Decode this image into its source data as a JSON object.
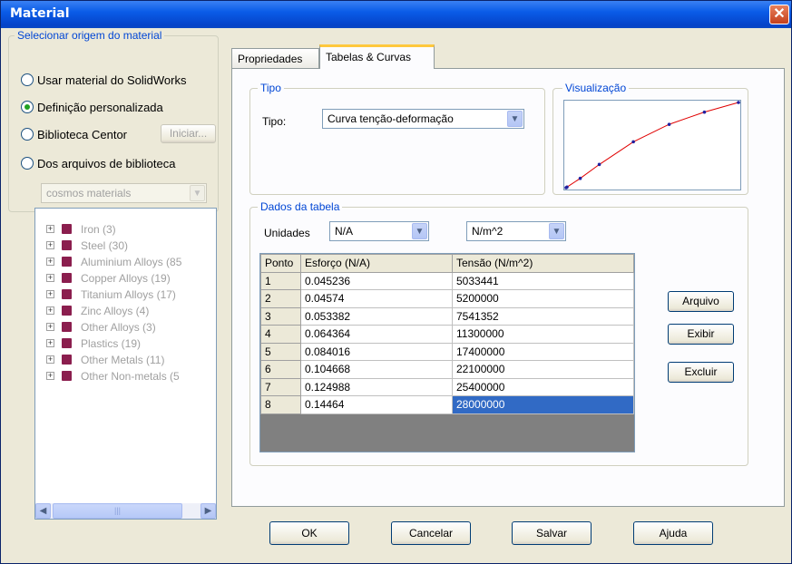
{
  "window": {
    "title": "Material"
  },
  "source": {
    "legend": "Selecionar origem do material",
    "options": [
      {
        "label": "Usar material do SolidWorks",
        "selected": false
      },
      {
        "label": "Definição personalizada",
        "selected": true
      },
      {
        "label": "Biblioteca Centor",
        "selected": false
      },
      {
        "label": "Dos arquivos de biblioteca",
        "selected": false
      }
    ],
    "iniciar_label": "Iniciar...",
    "library_value": "cosmos materials",
    "tree": [
      "Iron (3)",
      "Steel (30)",
      "Aluminium Alloys (85",
      "Copper Alloys (19)",
      "Titanium Alloys (17)",
      "Zinc Alloys (4)",
      "Other Alloys (3)",
      "Plastics (19)",
      "Other Metals (11)",
      "Other Non-metals (5"
    ]
  },
  "tabs": [
    {
      "label": "Propriedades",
      "active": false
    },
    {
      "label": "Tabelas & Curvas",
      "active": true
    }
  ],
  "tipo": {
    "legend": "Tipo",
    "label": "Tipo:",
    "value": "Curva tenção-deformação"
  },
  "preview": {
    "legend": "Visualização",
    "line_color": "#e00000",
    "point_color": "#2020a0"
  },
  "table_data": {
    "legend": "Dados da tabela",
    "units_label": "Unidades",
    "unit_strain": "N/A",
    "unit_stress": "N/m^2",
    "headers": [
      "Ponto",
      "Esforço (N/A)",
      "Tensão (N/m^2)"
    ],
    "rows": [
      [
        "1",
        "0.045236",
        "5033441"
      ],
      [
        "2",
        "0.04574",
        "5200000"
      ],
      [
        "3",
        "0.053382",
        "7541352"
      ],
      [
        "4",
        "0.064364",
        "11300000"
      ],
      [
        "5",
        "0.084016",
        "17400000"
      ],
      [
        "6",
        "0.104668",
        "22100000"
      ],
      [
        "7",
        "0.124988",
        "25400000"
      ],
      [
        "8",
        "0.14464",
        "28000000"
      ]
    ],
    "buttons": [
      "Arquivo",
      "Exibir",
      "Excluir"
    ]
  },
  "footer": {
    "ok": "OK",
    "cancel": "Cancelar",
    "save": "Salvar",
    "help": "Ajuda"
  }
}
